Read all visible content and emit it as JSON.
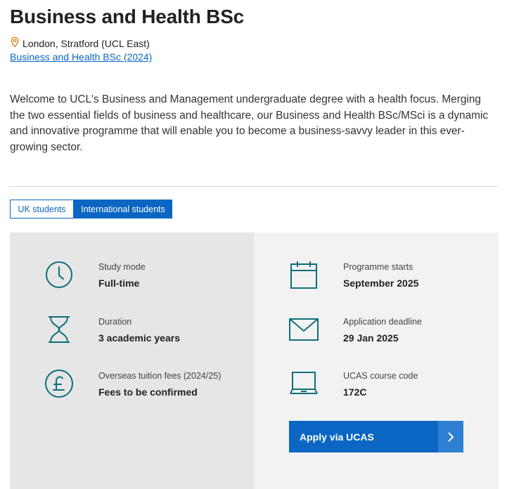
{
  "header": {
    "title": "Business and Health BSc",
    "location": "London, Stratford (UCL East)",
    "course_link": "Business and Health BSc (2024)"
  },
  "intro": "Welcome to UCL's Business and Management undergraduate degree with a health focus. Merging the two essential fields of business and healthcare, our Business and Health BSc/MSci is a dynamic and innovative programme that will enable you to become a business-savvy leader in this ever-growing sector.",
  "tabs": [
    {
      "label": "UK students",
      "active": false
    },
    {
      "label": "International students",
      "active": true
    }
  ],
  "facts": {
    "study_mode": {
      "label": "Study mode",
      "value": "Full-time",
      "icon": "clock-icon"
    },
    "duration": {
      "label": "Duration",
      "value": "3 academic years",
      "icon": "hourglass-icon"
    },
    "fees": {
      "label": "Overseas tuition fees (2024/25)",
      "value": "Fees to be confirmed",
      "icon": "pound-icon"
    },
    "start": {
      "label": "Programme starts",
      "value": "September 2025",
      "icon": "calendar-icon"
    },
    "deadline": {
      "label": "Application deadline",
      "value": "29 Jan 2025",
      "icon": "envelope-icon"
    },
    "ucas": {
      "label": "UCAS course code",
      "value": "172C",
      "icon": "laptop-icon"
    }
  },
  "apply": {
    "label": "Apply via UCAS",
    "icon": "chevron-right-icon"
  },
  "colors": {
    "accent": "#0a66c2",
    "icon_teal": "#0f6e79",
    "pin_orange": "#e37e1b",
    "panel_left": "#e6e6e6",
    "panel_right": "#f2f2f2"
  }
}
